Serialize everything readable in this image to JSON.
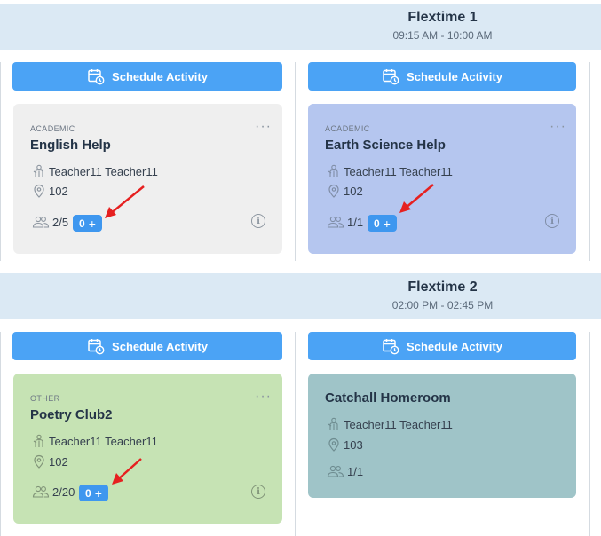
{
  "flextimes": [
    {
      "title": "Flextime 1",
      "time": "09:15 AM - 10:00 AM",
      "schedule_label": "Schedule Activity",
      "cards": [
        {
          "category": "ACADEMIC",
          "name": "English Help",
          "teacher": "Teacher11 Teacher11",
          "room": "102",
          "enrollment": "2/5",
          "pill_count": "0"
        },
        {
          "category": "ACADEMIC",
          "name": "Earth Science Help",
          "teacher": "Teacher11 Teacher11",
          "room": "102",
          "enrollment": "1/1",
          "pill_count": "0"
        }
      ]
    },
    {
      "title": "Flextime 2",
      "time": "02:00 PM - 02:45 PM",
      "schedule_label": "Schedule Activity",
      "cards": [
        {
          "category": "OTHER",
          "name": "Poetry Club2",
          "teacher": "Teacher11 Teacher11",
          "room": "102",
          "enrollment": "2/20",
          "pill_count": "0"
        },
        {
          "category": "",
          "name": "Catchall Homeroom",
          "teacher": "Teacher11 Teacher11",
          "room": "103",
          "enrollment": "1/1",
          "pill_count": ""
        }
      ]
    }
  ],
  "colors": {
    "band": "#dbe9f4",
    "button": "#4ba3f5",
    "card_gray": "#efefef",
    "card_blue": "#b5c6ef",
    "card_green": "#c6e3b4",
    "card_teal": "#9fc4c8",
    "annotation_arrow": "#e62020"
  },
  "icons": {
    "schedule": "calendar-clock-icon",
    "teacher": "teacher-icon",
    "room": "location-pin-icon",
    "enrollment": "people-icon",
    "menu": "more-dots-icon",
    "info": "info-icon"
  }
}
